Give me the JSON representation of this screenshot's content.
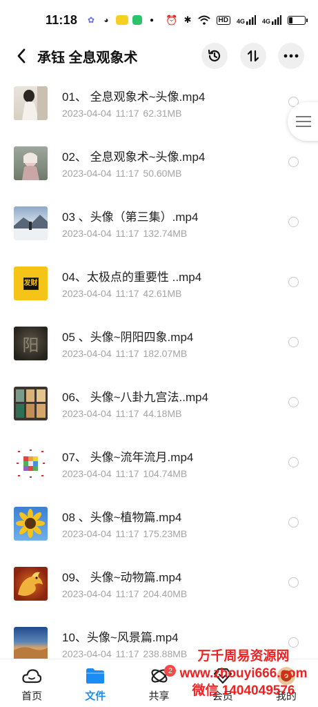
{
  "status_bar": {
    "time": "11:18",
    "signal_1": "4G",
    "signal_2": "4G",
    "hd_label": "HD",
    "battery_level_percent": 25
  },
  "header": {
    "title": "承钰 全息观象术",
    "back_icon": "chevron-left-icon",
    "history_icon": "history-icon",
    "sort_icon": "sort-icon",
    "more_icon": "more-icon"
  },
  "files": [
    {
      "name": "01、 全息观象术~头像.mp4",
      "date": "2023-04-04",
      "time": "11:17",
      "size": "62.31MB",
      "thumb": "portrait-woman"
    },
    {
      "name": "02、 全息观象术~头像.mp4",
      "date": "2023-04-04",
      "time": "11:17",
      "size": "50.60MB",
      "thumb": "portrait-girl"
    },
    {
      "name": "03 、头像（第三集）.mp4",
      "date": "2023-04-04",
      "time": "11:17",
      "size": "132.74MB",
      "thumb": "landscape-mountain"
    },
    {
      "name": "04、太极点的重要性 ..mp4",
      "date": "2023-04-04",
      "time": "11:17",
      "size": "42.61MB",
      "thumb": "fortune-sign",
      "thumb_text": "发财"
    },
    {
      "name": "05 、头像~阴阳四象.mp4",
      "date": "2023-04-04",
      "time": "11:17",
      "size": "182.07MB",
      "thumb": "dark-calligraphy",
      "thumb_text": "阳"
    },
    {
      "name": "06、 头像~八卦九宫法..mp4",
      "date": "2023-04-04",
      "time": "11:17",
      "size": "44.18MB",
      "thumb": "window-grid"
    },
    {
      "name": "07、 头像~流年流月.mp4",
      "date": "2023-04-04",
      "time": "11:17",
      "size": "104.74MB",
      "thumb": "colored-grid"
    },
    {
      "name": "08 、头像~植物篇.mp4",
      "date": "2023-04-04",
      "time": "11:17",
      "size": "175.23MB",
      "thumb": "sunflower"
    },
    {
      "name": "09、 头像~动物篇.mp4",
      "date": "2023-04-04",
      "time": "11:17",
      "size": "204.40MB",
      "thumb": "dragon"
    },
    {
      "name": "10、头像~风景篇.mp4",
      "date": "2023-04-04",
      "time": "11:17",
      "size": "238.88MB",
      "thumb": "desert"
    }
  ],
  "bottom_nav": [
    {
      "label": "首页",
      "icon": "cloud-icon",
      "active": false
    },
    {
      "label": "文件",
      "icon": "folder-icon",
      "active": true
    },
    {
      "label": "共享",
      "icon": "share-orbit-icon",
      "active": false,
      "badge": "2"
    },
    {
      "label": "会员",
      "icon": "diamond-icon",
      "active": false
    },
    {
      "label": "我的",
      "icon": "avatar-icon",
      "active": false
    }
  ],
  "watermark": {
    "line1": "万千周易资源网",
    "line2": "www.zhouyi666.com",
    "line3": "微信 1404049576"
  },
  "colors": {
    "accent": "#1b8df2",
    "meta_text": "#a4a4a4",
    "badge": "#f04a4a",
    "watermark": "#ee2222"
  }
}
